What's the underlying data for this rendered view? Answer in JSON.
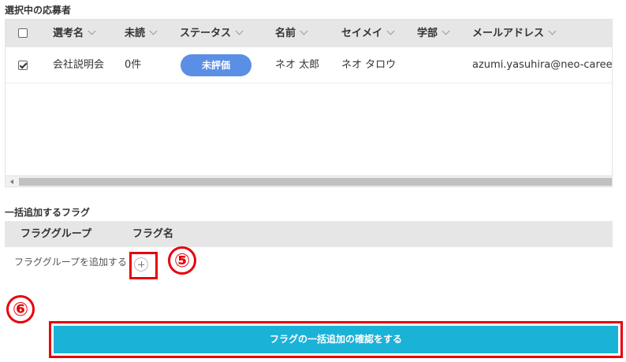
{
  "applicants": {
    "title": "選択中の応募者",
    "columns": [
      "選考名",
      "未読",
      "ステータス",
      "名前",
      "セイメイ",
      "学部",
      "メールアドレス"
    ],
    "rows": [
      {
        "checked": true,
        "selection": "会社説明会",
        "unread": "0件",
        "status": "未評価",
        "name": "ネオ 太郎",
        "kana": "ネオ タロウ",
        "faculty": "",
        "email": "azumi.yasuhira@neo-career.co"
      }
    ]
  },
  "flags": {
    "title": "一括追加するフラグ",
    "columns": [
      "フラググループ",
      "フラグ名"
    ],
    "add_group_label": "フラググループを追加する"
  },
  "annotations": {
    "step5": "⑤",
    "step6": "⑥"
  },
  "confirm_button": "フラグの一括追加の確認をする",
  "colors": {
    "status_pill": "#5b8fe6",
    "confirm_button": "#1bb2d8",
    "highlight": "#e8000b"
  }
}
